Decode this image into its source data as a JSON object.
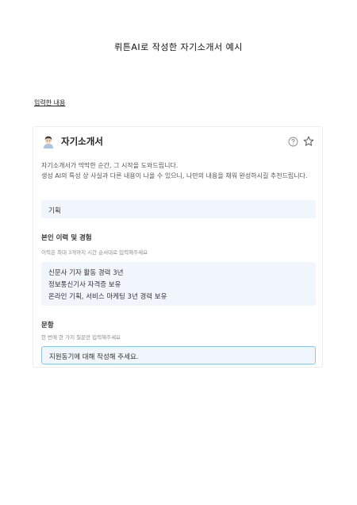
{
  "document": {
    "title": "뤼튼AI로 작성한 자기소개서 예시",
    "section_label": "입력한 내용"
  },
  "card": {
    "title": "자기소개서",
    "icons": [
      "avatar-icon",
      "help-circle-icon",
      "star-icon"
    ],
    "description_line1": "자기소개서가 막막한 순간, 그 시작을 도와드립니다.",
    "description_line2": "생성 AI의 특성 상 사실과 다른 내용이 나올 수 있으니, 나만의 내용을 채워 완성하시길 추천드립니다.",
    "field_plan": "기획",
    "experience": {
      "heading": "본인 이력 및 경험",
      "hint": "이력은 최대 3개까지 시간 순서대로 입력해주세요",
      "items": [
        "신문사 기자 활동 경력 3년",
        "정보통신기사 자격증 보유",
        "온라인 기획, 서비스 마케팅 3년 경력 보유"
      ]
    },
    "question": {
      "heading": "문항",
      "hint": "한 번에 한 가지 질문만 입력해주세요",
      "value": "지원동기에 대해 작성해 주세요."
    }
  }
}
